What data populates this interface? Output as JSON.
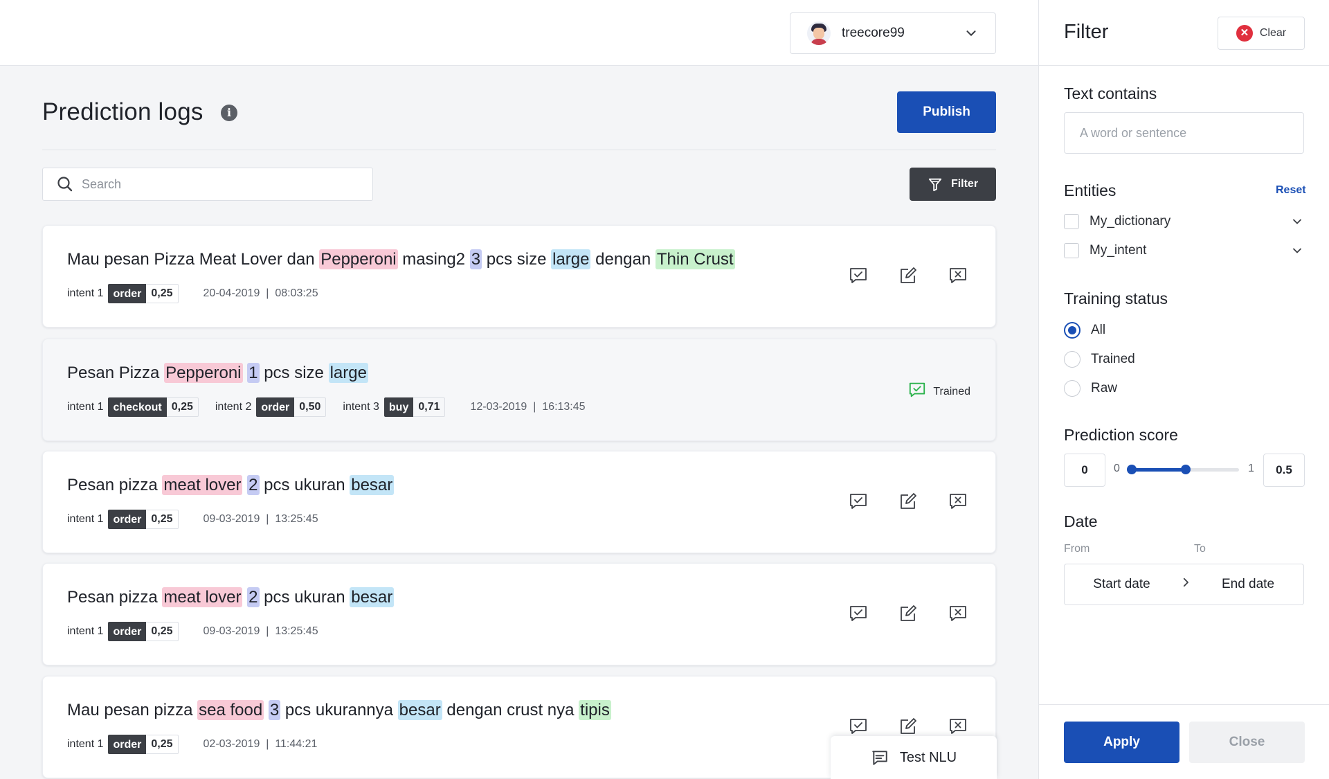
{
  "header": {
    "user_name": "treecore99"
  },
  "main": {
    "title": "Prediction logs",
    "publish_label": "Publish",
    "search_placeholder": "Search",
    "filter_label": "Filter",
    "logs": [
      {
        "segments": [
          {
            "text": "Mau pesan Pizza Meat Lover dan ",
            "entity": null
          },
          {
            "text": "Pepperoni",
            "entity": "pink"
          },
          {
            "text": " masing2 ",
            "entity": null
          },
          {
            "text": "3",
            "entity": "purple"
          },
          {
            "text": " pcs size ",
            "entity": null
          },
          {
            "text": "large",
            "entity": "blue"
          },
          {
            "text": " dengan ",
            "entity": null
          },
          {
            "text": "Thin Crust",
            "entity": "green"
          }
        ],
        "intents": [
          {
            "label": "intent 1",
            "name": "order",
            "score": "0,25"
          }
        ],
        "timestamp": "20-04-2019  |  08:03:25",
        "trained": false
      },
      {
        "segments": [
          {
            "text": "Pesan Pizza ",
            "entity": null
          },
          {
            "text": "Pepperoni",
            "entity": "pink"
          },
          {
            "text": " ",
            "entity": null
          },
          {
            "text": "1",
            "entity": "purple"
          },
          {
            "text": " pcs size ",
            "entity": null
          },
          {
            "text": "large",
            "entity": "blue"
          }
        ],
        "intents": [
          {
            "label": "intent 1",
            "name": "checkout",
            "score": "0,25"
          },
          {
            "label": "intent 2",
            "name": "order",
            "score": "0,50"
          },
          {
            "label": "intent 3",
            "name": "buy",
            "score": "0,71"
          }
        ],
        "timestamp": "12-03-2019  |  16:13:45",
        "trained": true,
        "trained_label": "Trained"
      },
      {
        "segments": [
          {
            "text": "Pesan pizza ",
            "entity": null
          },
          {
            "text": "meat lover",
            "entity": "pink"
          },
          {
            "text": " ",
            "entity": null
          },
          {
            "text": "2",
            "entity": "purple"
          },
          {
            "text": " pcs ukuran ",
            "entity": null
          },
          {
            "text": "besar",
            "entity": "blue"
          }
        ],
        "intents": [
          {
            "label": "intent 1",
            "name": "order",
            "score": "0,25"
          }
        ],
        "timestamp": "09-03-2019  |  13:25:45",
        "trained": false
      },
      {
        "segments": [
          {
            "text": "Pesan pizza ",
            "entity": null
          },
          {
            "text": "meat lover",
            "entity": "pink"
          },
          {
            "text": " ",
            "entity": null
          },
          {
            "text": "2",
            "entity": "purple"
          },
          {
            "text": " pcs ukuran ",
            "entity": null
          },
          {
            "text": "besar",
            "entity": "blue"
          }
        ],
        "intents": [
          {
            "label": "intent 1",
            "name": "order",
            "score": "0,25"
          }
        ],
        "timestamp": "09-03-2019  |  13:25:45",
        "trained": false
      },
      {
        "segments": [
          {
            "text": "Mau pesan pizza ",
            "entity": null
          },
          {
            "text": "sea food",
            "entity": "pink"
          },
          {
            "text": " ",
            "entity": null
          },
          {
            "text": "3",
            "entity": "purple"
          },
          {
            "text": " pcs ukurannya ",
            "entity": null
          },
          {
            "text": "besar",
            "entity": "blue"
          },
          {
            "text": " dengan crust nya ",
            "entity": null
          },
          {
            "text": "tipis",
            "entity": "green"
          }
        ],
        "intents": [
          {
            "label": "intent 1",
            "name": "order",
            "score": "0,25"
          }
        ],
        "timestamp": "02-03-2019  |  11:44:21",
        "trained": false
      }
    ],
    "test_nlu_label": "Test NLU"
  },
  "filter_panel": {
    "title": "Filter",
    "clear_label": "Clear",
    "text_contains": {
      "title": "Text contains",
      "placeholder": "A word or sentence"
    },
    "entities": {
      "title": "Entities",
      "reset_label": "Reset",
      "items": [
        "My_dictionary",
        "My_intent"
      ]
    },
    "training_status": {
      "title": "Training status",
      "options": [
        "All",
        "Trained",
        "Raw"
      ],
      "selected": "All"
    },
    "prediction_score": {
      "title": "Prediction score",
      "min_value": "0",
      "min_label": "0",
      "max_label": "1",
      "max_value": "0.5",
      "range_selected": [
        0,
        0.5
      ]
    },
    "date": {
      "title": "Date",
      "from_label": "From",
      "to_label": "To",
      "start_placeholder": "Start date",
      "end_placeholder": "End date"
    },
    "apply_label": "Apply",
    "close_label": "Close"
  },
  "colors": {
    "primary": "#1a4fb5",
    "dark_button": "#3c3f45",
    "entity_pink": "#f8c9d6",
    "entity_purple": "#c5cbf3",
    "entity_blue": "#c3e5f7",
    "entity_green": "#c8f1cc",
    "trained_green": "#2bb24c",
    "clear_red": "#e0303e"
  },
  "icons": {
    "info": "info-icon",
    "search": "search-icon",
    "filter": "funnel-icon",
    "approve": "check-message-icon",
    "edit": "edit-icon",
    "reject": "x-message-icon",
    "chat": "chat-icon",
    "chevron": "chevron-down-icon"
  }
}
